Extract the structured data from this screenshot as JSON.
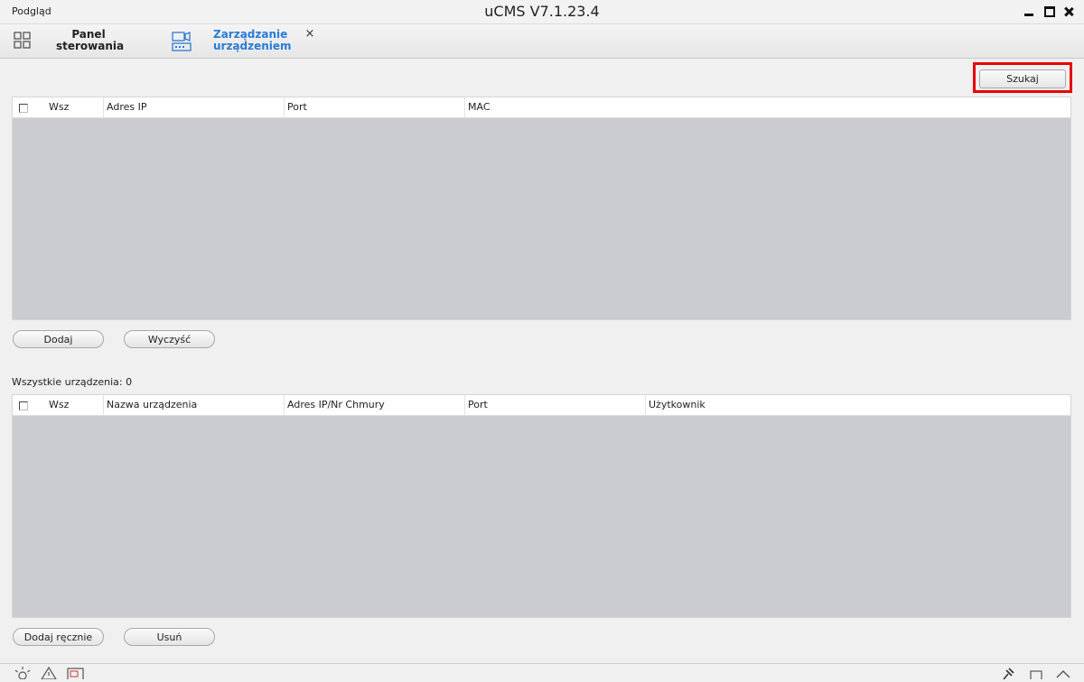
{
  "window": {
    "left_title": "Podgląd",
    "title": "uCMS V7.1.23.4"
  },
  "tabs": [
    {
      "label": "Panel\nsterowania",
      "icon": "grid-icon",
      "active": false
    },
    {
      "label": "Zarządzanie\nurządzeniem",
      "icon": "device-management-icon",
      "active": true,
      "color": "#2a7bd6"
    }
  ],
  "tab_close": "×",
  "search_button": "Szukaj",
  "search_table": {
    "columns": [
      "Wsz",
      "Adres IP",
      "Port",
      "MAC"
    ],
    "rows": []
  },
  "search_actions": {
    "add": "Dodaj",
    "clear": "Wyczyść"
  },
  "devices_count_label": "Wszystkie urządzenia: 0",
  "devices_table": {
    "columns": [
      "Wsz",
      "Nazwa urządzenia",
      "Adres IP/Nr Chmury",
      "Port",
      "Użytkownik"
    ],
    "rows": []
  },
  "device_actions": {
    "add_manual": "Dodaj ręcznie",
    "remove": "Usuń"
  },
  "colors": {
    "highlight": "#e80000",
    "accent": "#2a7bd6",
    "table_body": "#cbccd0"
  },
  "statusbar_icons": [
    "brightness-icon",
    "alarm-icon",
    "image-icon",
    "pin-icon",
    "window-icon",
    "collapse-icon"
  ]
}
